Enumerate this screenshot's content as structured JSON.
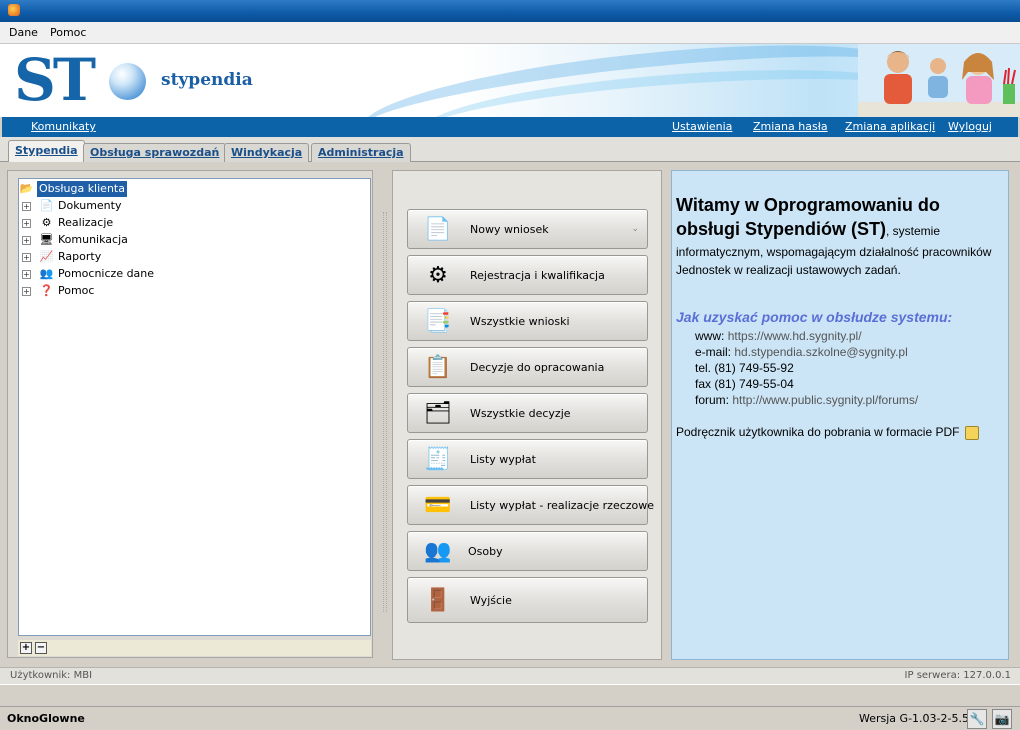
{
  "menu": {
    "items": [
      "Dane",
      "Pomoc"
    ]
  },
  "banner": {
    "logo_text": "ST",
    "app_name": "stypendia"
  },
  "topnav": {
    "left_link": "Komunikaty",
    "right_links": [
      "Ustawienia",
      "Zmiana hasła",
      "Zmiana aplikacji",
      "Wyloguj"
    ]
  },
  "tabs": [
    "Stypendia",
    "Obsługa sprawozdań",
    "Windykacja",
    "Administracja"
  ],
  "tree": {
    "root": "Obsługa klienta",
    "items": [
      "Dokumenty",
      "Realizacje",
      "Komunikacja",
      "Raporty",
      "Pomocnicze dane",
      "Pomoc"
    ]
  },
  "actions": [
    {
      "label": "Nowy wniosek",
      "icon": "document-icon"
    },
    {
      "label": "Rejestracja i kwalifikacja",
      "icon": "gear-document-icon"
    },
    {
      "label": "Wszystkie wnioski",
      "icon": "documents-icon"
    },
    {
      "label": "Decyzje do opracowania",
      "icon": "decision-coins-icon"
    },
    {
      "label": "Wszystkie decyzje",
      "icon": "decisions-coins-icon"
    },
    {
      "label": "Listy wypłat",
      "icon": "cash-register-icon"
    },
    {
      "label": "Listy wypłat - realizacje rzeczowe",
      "icon": "cash-register-card-icon"
    },
    {
      "label": "Osoby",
      "icon": "people-icon"
    },
    {
      "label": "Wyjście",
      "icon": "door-icon"
    }
  ],
  "welcome": {
    "title": "Witamy w Oprogramowaniu do obsługi Stypendiów (ST)",
    "title_rest": ", systemie",
    "body": "informatycznym, wspomagającym działalność pracowników Jednostek w realizacji ustawowych zadań.",
    "help_title": "Jak uzyskać pomoc w obsłudze systemu:",
    "contacts": [
      {
        "label": "www:",
        "value": "https://www.hd.sygnity.pl/"
      },
      {
        "label": "e-mail:",
        "value": "hd.stypendia.szkolne@sygnity.pl"
      },
      {
        "label": "tel.",
        "value": "(81) 749-55-92"
      },
      {
        "label": "fax",
        "value": "(81) 749-55-04"
      },
      {
        "label": "forum:",
        "value": "http://www.public.sygnity.pl/forums/"
      }
    ],
    "pdf_text": "Podręcznik użytkownika do pobrania w formacie PDF"
  },
  "status": {
    "user": "Użytkownik: MBI",
    "server": "IP serwera: 127.0.0.1",
    "window_name": "OknoGlowne",
    "version": "Wersja G-1.03-2-5.5"
  },
  "colors": {
    "nav_blue": "#0d63a8",
    "info_bg": "#cce5f6",
    "link_purple": "#5a6fd6"
  }
}
